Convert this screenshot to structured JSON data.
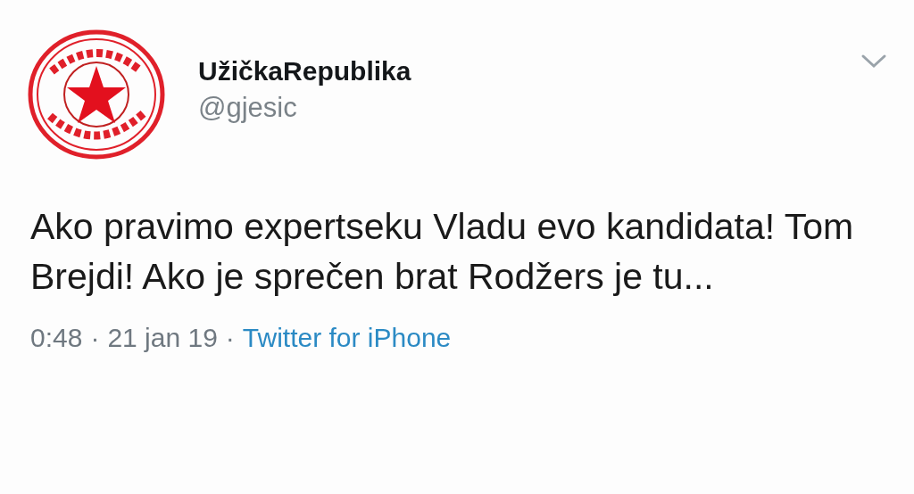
{
  "tweet": {
    "display_name": "UžičkaRepublika",
    "handle": "@gjesic",
    "text": "Ako pravimo expertseku Vladu evo kandidata! Tom Brejdi! Ako je sprečen brat Rodžers je tu...",
    "time": "0:48",
    "separator_1": "·",
    "date": "21 jan 19",
    "separator_2": "·",
    "source": "Twitter for iPhone"
  }
}
